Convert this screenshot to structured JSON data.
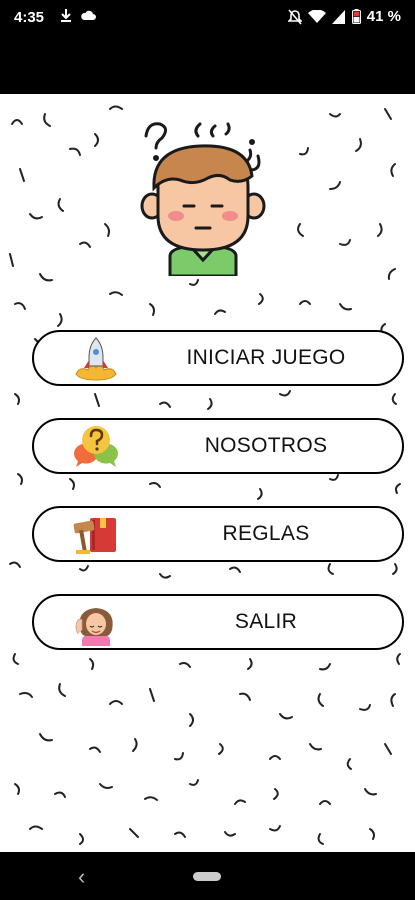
{
  "status_bar": {
    "time": "4:35",
    "battery": "41 %",
    "icons": [
      "download-icon",
      "cloud-icon",
      "mute-icon",
      "wifi-icon",
      "signal-icon",
      "battery-icon"
    ]
  },
  "menu": {
    "items": [
      {
        "id": "start",
        "label": "INICIAR JUEGO",
        "icon": "rocket-icon"
      },
      {
        "id": "about",
        "label": "NOSOTROS",
        "icon": "question-chat-icon"
      },
      {
        "id": "rules",
        "label": "REGLAS",
        "icon": "gavel-book-icon"
      },
      {
        "id": "exit",
        "label": "SALIR",
        "icon": "girl-waving-icon"
      }
    ]
  },
  "colors": {
    "background": "#ffffff",
    "border": "#000000",
    "rocket_flame": "#f5b731",
    "chat_orange": "#f26b3a",
    "chat_green": "#8bc34a",
    "chat_yellow": "#f5c542",
    "book_red": "#d63a36",
    "hair": "#c8864f",
    "shirt": "#7ccb6a"
  }
}
